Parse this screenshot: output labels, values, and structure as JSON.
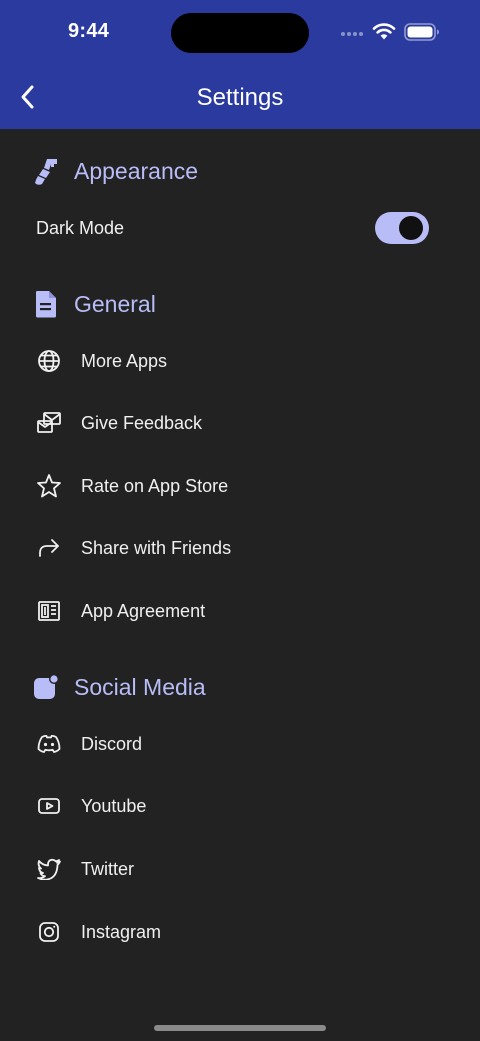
{
  "status_bar": {
    "time": "9:44"
  },
  "nav": {
    "title": "Settings",
    "back_icon": "chevron-left-icon"
  },
  "colors": {
    "header_bg": "#2a3a9e",
    "page_bg": "#222222",
    "accent": "#b8bcf7",
    "text": "#f0f0f0"
  },
  "sections": {
    "appearance": {
      "title": "Appearance",
      "icon": "paintbrush-icon",
      "items": [
        {
          "label": "Dark Mode",
          "toggle_on": true
        }
      ]
    },
    "general": {
      "title": "General",
      "icon": "document-icon",
      "items": [
        {
          "label": "More Apps",
          "icon": "globe-icon"
        },
        {
          "label": "Give Feedback",
          "icon": "feedback-icon"
        },
        {
          "label": "Rate on App Store",
          "icon": "star-icon"
        },
        {
          "label": "Share with Friends",
          "icon": "share-arrow-icon"
        },
        {
          "label": "App Agreement",
          "icon": "agreement-icon"
        }
      ]
    },
    "social": {
      "title": "Social Media",
      "icon": "app-badge-icon",
      "items": [
        {
          "label": "Discord",
          "icon": "discord-icon"
        },
        {
          "label": "Youtube",
          "icon": "youtube-icon"
        },
        {
          "label": "Twitter",
          "icon": "twitter-icon"
        },
        {
          "label": "Instagram",
          "icon": "instagram-icon"
        }
      ]
    }
  }
}
